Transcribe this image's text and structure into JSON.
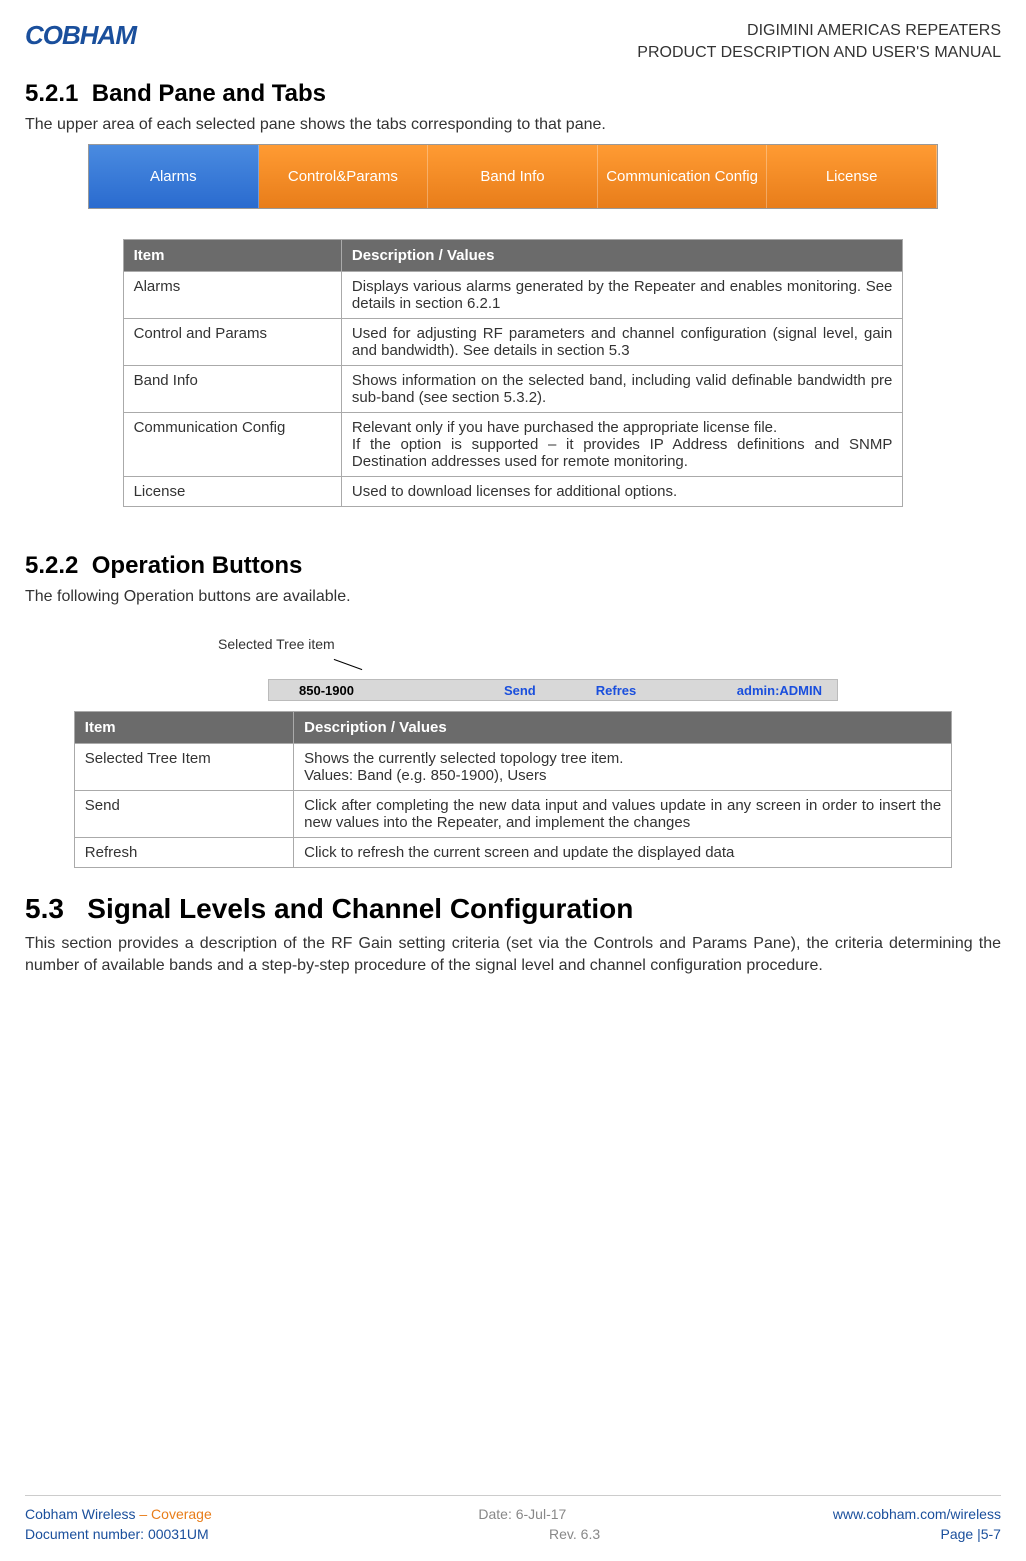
{
  "header": {
    "logo": "COBHAM",
    "line1": "DIGIMINI AMERICAS REPEATERS",
    "line2": "PRODUCT DESCRIPTION AND USER'S MANUAL"
  },
  "section521": {
    "number": "5.2.1",
    "title": "Band Pane and Tabs",
    "intro": "The upper area of each selected pane shows the tabs corresponding to that pane."
  },
  "tabs": {
    "items": [
      "Alarms",
      "Control&Params",
      "Band Info",
      "Communication Config",
      "License"
    ]
  },
  "table1": {
    "head_item": "Item",
    "head_desc": "Description / Values",
    "rows": [
      {
        "item": "Alarms",
        "desc": "Displays various alarms generated by the Repeater and enables monitoring. See details in section 6.2.1"
      },
      {
        "item": "Control and Params",
        "desc": "Used for adjusting RF parameters and channel configuration (signal level, gain and bandwidth). See details in section 5.3"
      },
      {
        "item": "Band Info",
        "desc": "Shows information on the selected band, including valid definable bandwidth pre sub-band (see section 5.3.2)."
      },
      {
        "item": "Communication Config",
        "desc": "Relevant only if you have purchased the appropriate license file.\nIf the option is supported – it provides IP Address definitions and SNMP Destination addresses used for remote monitoring."
      },
      {
        "item": "License",
        "desc": "Used to download licenses for additional options."
      }
    ]
  },
  "section522": {
    "number": "5.2.2",
    "title": "Operation Buttons",
    "intro": "The following Operation buttons are available."
  },
  "diagram": {
    "label": "Selected Tree item",
    "tree_value": "850-1900",
    "send": "Send",
    "refresh": "Refres",
    "admin": "admin:ADMIN"
  },
  "table2": {
    "head_item": "Item",
    "head_desc": "Description / Values",
    "rows": [
      {
        "item": "Selected Tree Item",
        "desc": "Shows the currently selected topology tree item.\nValues: Band (e.g. 850-1900), Users"
      },
      {
        "item": "Send",
        "desc": "Click after completing the new data input and values update in any screen in order to insert the new values into the Repeater, and implement the changes"
      },
      {
        "item": "Refresh",
        "desc": "Click to refresh the current screen and update the displayed data"
      }
    ]
  },
  "section53": {
    "number": "5.3",
    "title": "Signal Levels and Channel Configuration",
    "body": "This section provides a description of the RF Gain setting criteria (set via the Controls and Params Pane), the criteria determining the number of available bands and a step-by-step procedure of the signal level and channel configuration procedure."
  },
  "footer": {
    "brand": "Cobham Wireless",
    "tag": " – Coverage",
    "date": "Date: 6-Jul-17",
    "url": "www.cobham.com/wireless",
    "doc": "Document number: 00031UM",
    "rev": "Rev. 6.3",
    "page": "Page |5-7"
  }
}
